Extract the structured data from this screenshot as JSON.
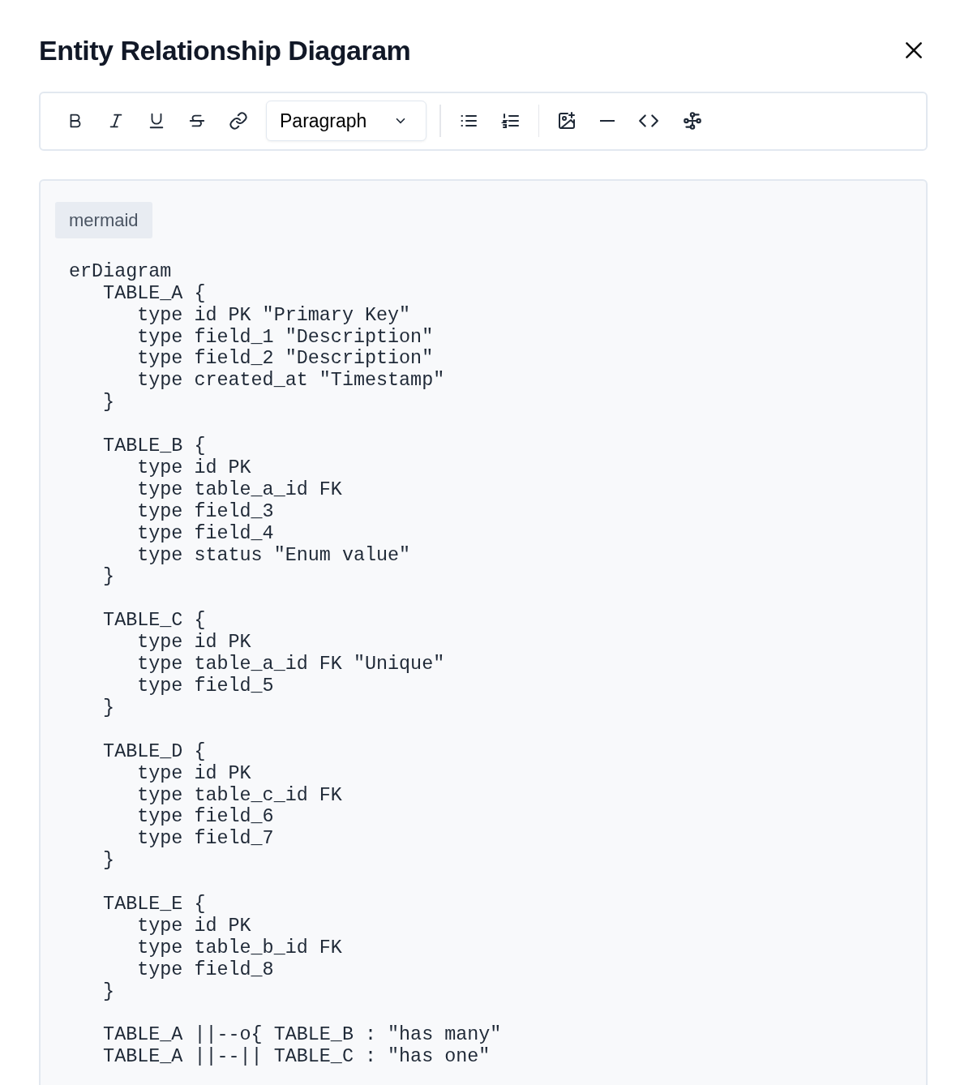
{
  "dialog": {
    "title": "Entity Relationship Diagaram"
  },
  "toolbar": {
    "block_style": "Paragraph"
  },
  "code_block": {
    "language": "mermaid",
    "blocks": [
      {
        "lines": [
          "erDiagram",
          "   TABLE_A {",
          "      type id PK \"Primary Key\"",
          "      type field_1 \"Description\"",
          "      type field_2 \"Description\"",
          "      type created_at \"Timestamp\"",
          "   }"
        ]
      },
      {
        "lines": [
          "   TABLE_B {",
          "      type id PK",
          "      type table_a_id FK",
          "      type field_3",
          "      type field_4",
          "      type status \"Enum value\"",
          "   }"
        ]
      },
      {
        "lines": [
          "   TABLE_C {",
          "      type id PK",
          "      type table_a_id FK \"Unique\"",
          "      type field_5",
          "   }"
        ]
      },
      {
        "lines": [
          "   TABLE_D {",
          "      type id PK",
          "      type table_c_id FK",
          "      type field_6",
          "      type field_7",
          "   }"
        ]
      },
      {
        "lines": [
          "   TABLE_E {",
          "      type id PK",
          "      type table_b_id FK",
          "      type field_8",
          "   }"
        ]
      },
      {
        "lines": [
          "   TABLE_A ||--o{ TABLE_B : \"has many\"",
          "   TABLE_A ||--|| TABLE_C : \"has one\""
        ]
      }
    ]
  }
}
